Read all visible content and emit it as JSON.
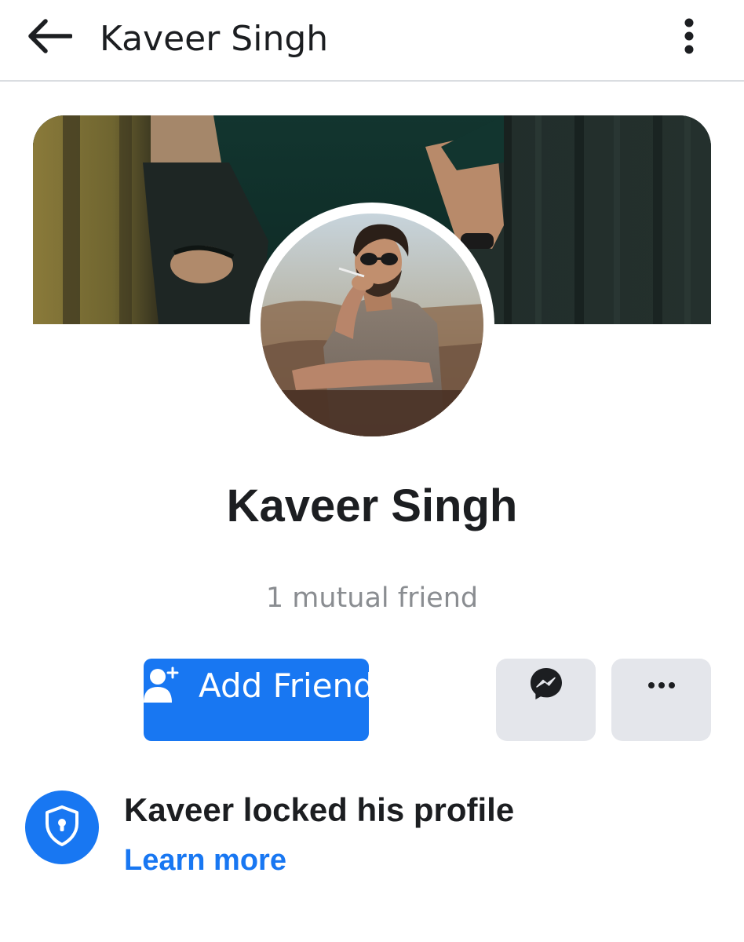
{
  "header": {
    "title": "Kaveer Singh",
    "back_icon": "back-arrow-icon",
    "menu_icon": "more-vertical-icon"
  },
  "profile": {
    "name": "Kaveer Singh",
    "mutual_friends": "1 mutual friend"
  },
  "actions": {
    "add_friend_label": "Add Friend",
    "add_friend_icon": "add-person-icon",
    "message_icon": "messenger-icon",
    "more_icon": "more-horizontal-icon"
  },
  "lock_notice": {
    "title": "Kaveer locked his profile",
    "link": "Learn more",
    "icon": "shield-lock-icon"
  },
  "colors": {
    "accent": "#1877f2",
    "text": "#1c1e21",
    "muted": "#8a8d91",
    "button_grey": "#e4e6eb"
  }
}
